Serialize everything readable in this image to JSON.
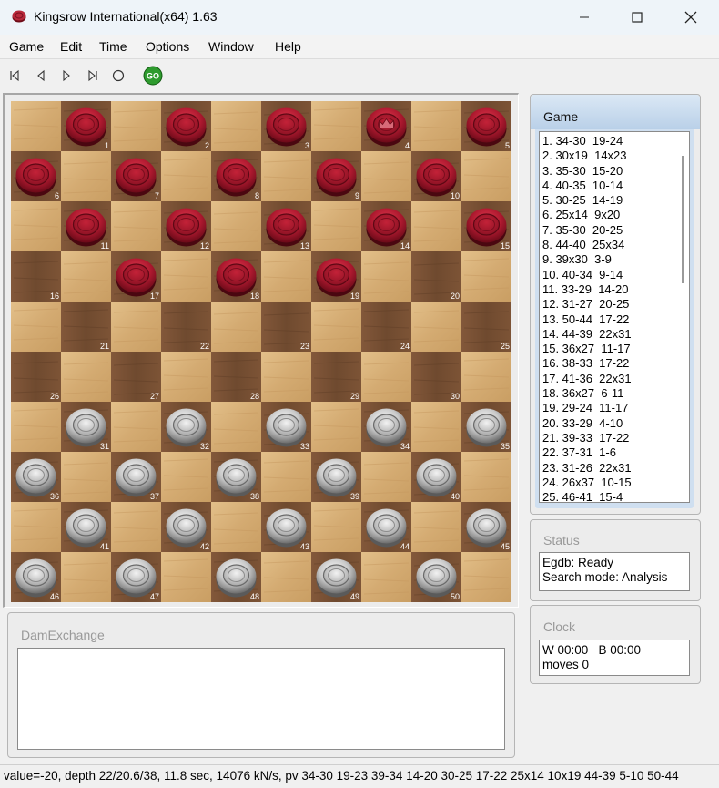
{
  "window": {
    "title": "Kingsrow International(x64) 1.63",
    "controls": [
      "minimize",
      "maximize",
      "close"
    ]
  },
  "menu": [
    "Game",
    "Edit",
    "Time",
    "Options",
    "Window",
    "Help"
  ],
  "toolbar": {
    "buttons": [
      "first-move-icon",
      "previous-move-icon",
      "next-move-icon",
      "last-move-icon",
      "circle-icon"
    ],
    "go_label": "GO",
    "go_color": "#2e9b2e"
  },
  "board": {
    "size": 10,
    "light_color": "#d7b079",
    "dark_color": "#7a5233",
    "black_piece_color": "#a0162b",
    "white_piece_color": "#c8c8c8",
    "pieces": {
      "1": "black",
      "2": "black",
      "3": "black",
      "4": "black-king",
      "5": "black",
      "6": "black",
      "7": "black",
      "8": "black",
      "9": "black",
      "10": "black",
      "11": "black",
      "12": "black",
      "13": "black",
      "14": "black",
      "15": "black",
      "17": "black",
      "18": "black",
      "19": "black",
      "31": "white",
      "32": "white",
      "33": "white",
      "34": "white",
      "35": "white",
      "36": "white",
      "37": "white",
      "38": "white",
      "39": "white",
      "40": "white",
      "41": "white",
      "42": "white",
      "43": "white",
      "44": "white",
      "45": "white",
      "46": "white",
      "47": "white",
      "48": "white",
      "49": "white",
      "50": "white"
    }
  },
  "game_panel": {
    "title": "Game",
    "moves": [
      "1. 34-30  19-24",
      "2. 30x19  14x23",
      "3. 35-30  15-20",
      "4. 40-35  10-14",
      "5. 30-25  14-19",
      "6. 25x14  9x20",
      "7. 35-30  20-25",
      "8. 44-40  25x34",
      "9. 39x30  3-9",
      "10. 40-34  9-14",
      "11. 33-29  14-20",
      "12. 31-27  20-25",
      "13. 50-44  17-22",
      "14. 44-39  22x31",
      "15. 36x27  11-17",
      "16. 38-33  17-22",
      "17. 41-36  22x31",
      "18. 36x27  6-11",
      "19. 29-24  11-17",
      "20. 33-29  4-10",
      "21. 39-33  17-22",
      "22. 37-31  1-6",
      "23. 31-26  22x31",
      "24. 26x37  10-15",
      "25. 46-41  15-4"
    ]
  },
  "status_panel": {
    "title": "Status",
    "lines": [
      "Egdb: Ready",
      "Search mode: Analysis"
    ]
  },
  "clock_panel": {
    "title": "Clock",
    "line1": "W 00:00   B 00:00",
    "line2": "moves 0"
  },
  "damexchange_panel": {
    "title": "DamExchange"
  },
  "statusbar": {
    "text": "value=-20,  depth 22/20.6/38,  11.8 sec,  14076 kN/s,  pv 34-30 19-23 39-34 14-20 30-25 17-22 25x14 10x19 44-39 5-10 50-44"
  }
}
